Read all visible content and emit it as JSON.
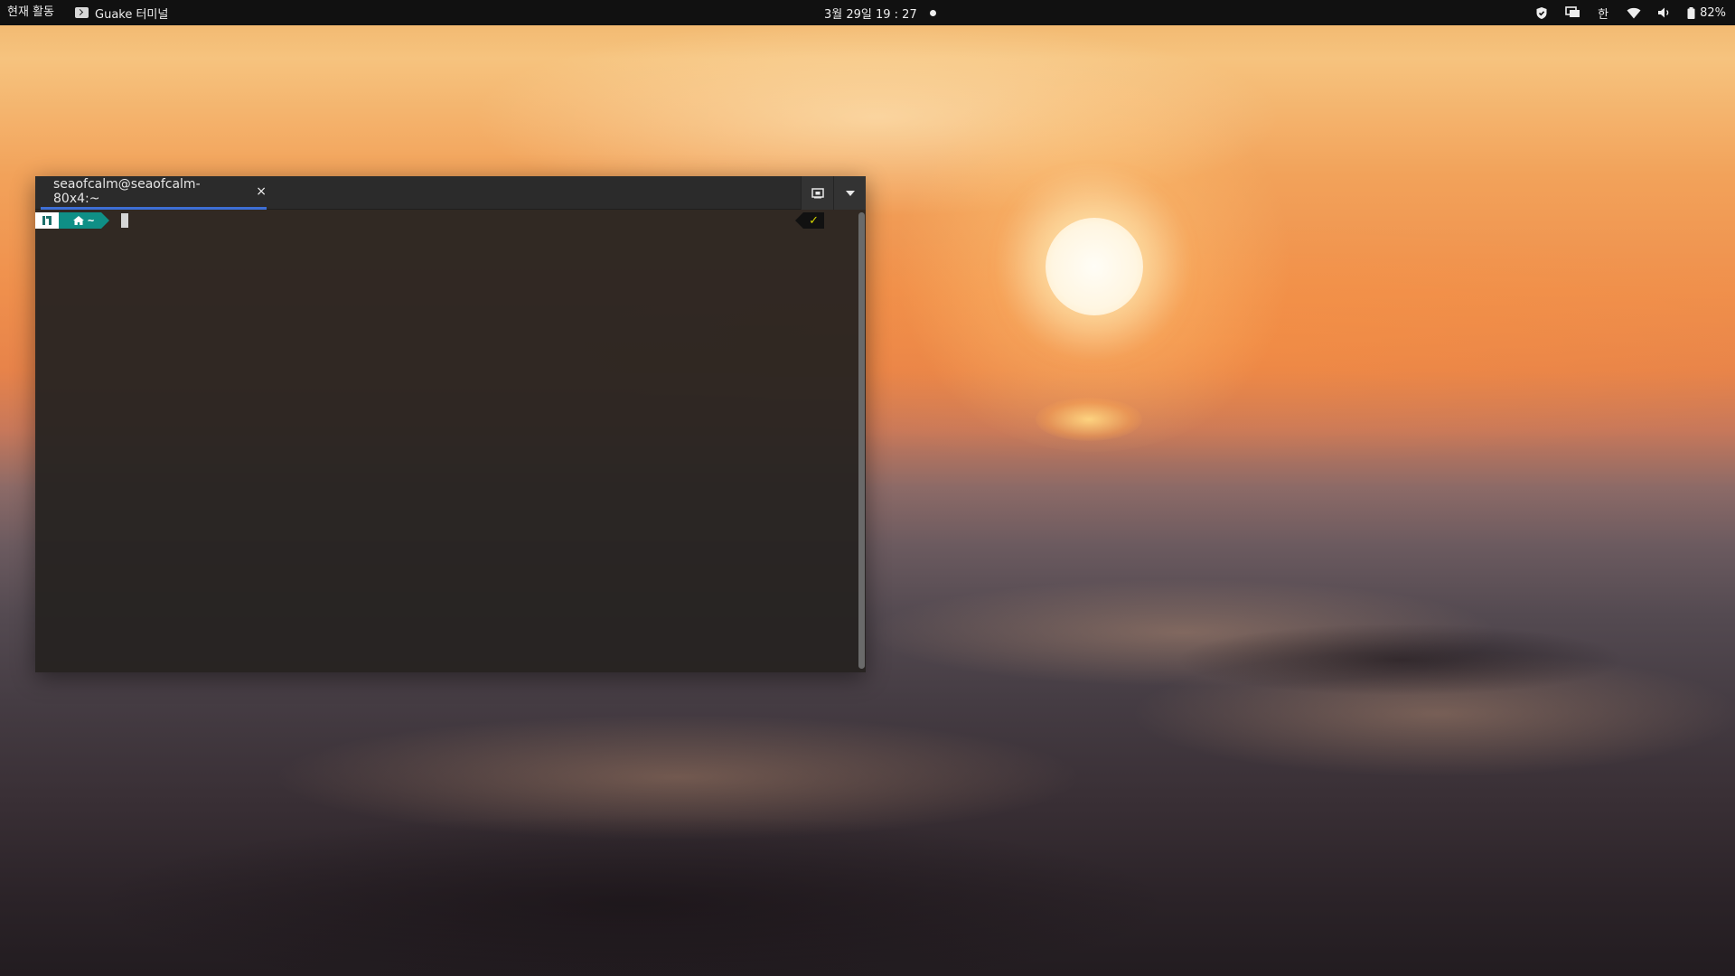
{
  "topbar": {
    "activities_label": "현재 활동",
    "app_name": "Guake 터미널",
    "clock": "3월 29일  19 : 27",
    "input_method": "한",
    "battery_percent": "82%"
  },
  "terminal": {
    "tab_title": "seaofcalm@seaofcalm-80x4:~",
    "tab_close_glyph": "×",
    "prompt_dir": "~",
    "prompt_status": "✓",
    "scroll_fraction": 1.0
  },
  "colors": {
    "topbar_bg": "#111111",
    "tab_underline": "#3d6fd6",
    "prompt_dir_bg": "#0f8f86",
    "prompt_status_fg": "#d6d600"
  },
  "icons": {
    "app": "terminal-icon",
    "shield": "shield-icon",
    "screen": "screen-share-icon",
    "wifi": "wifi-icon",
    "volume": "volume-icon",
    "battery": "battery-icon",
    "new_tab": "new-tab-icon",
    "menu": "chevron-down-icon",
    "os": "os-logo-icon",
    "home": "home-icon"
  }
}
